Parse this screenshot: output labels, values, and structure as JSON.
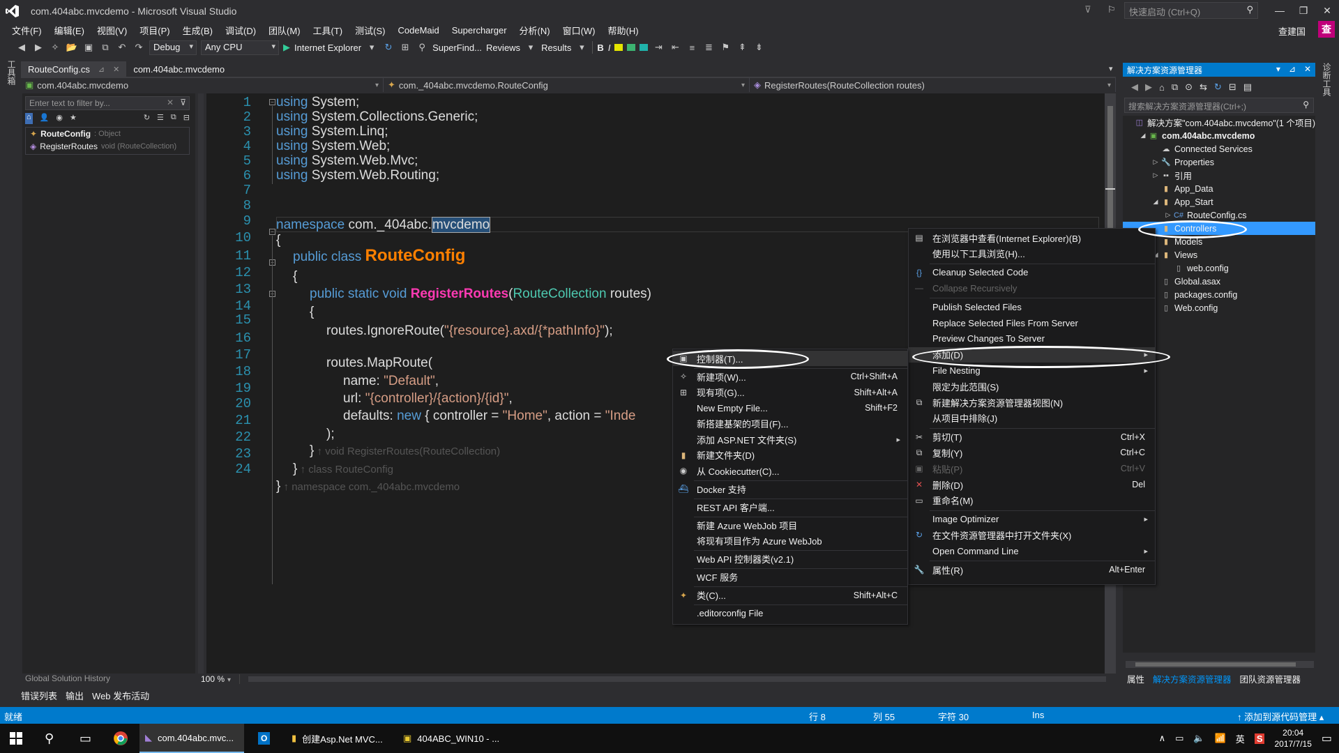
{
  "window": {
    "title": "com.404abc.mvcdemo - Microsoft Visual Studio",
    "quick_launch_placeholder": "快速启动 (Ctrl+Q)",
    "user_name": "查建国",
    "user_initial": "查"
  },
  "menubar": [
    "文件(F)",
    "编辑(E)",
    "视图(V)",
    "项目(P)",
    "生成(B)",
    "调试(D)",
    "团队(M)",
    "工具(T)",
    "测试(S)",
    "CodeMaid",
    "Supercharger",
    "分析(N)",
    "窗口(W)",
    "帮助(H)"
  ],
  "toolbar": {
    "config": "Debug",
    "platform": "Any CPU",
    "run_target": "Internet Explorer",
    "superfind": "SuperFind...",
    "reviews": "Reviews",
    "results": "Results",
    "bold": "B",
    "italic": "I"
  },
  "left_strip_label": "工具箱",
  "doc_tabs": [
    {
      "label": "RouteConfig.cs",
      "active": true
    },
    {
      "label": "com.404abc.mvcdemo",
      "active": false
    }
  ],
  "navbar": {
    "project": "com.404abc.mvcdemo",
    "class": "com._404abc.mvcdemo.RouteConfig",
    "member": "RegisterRoutes(RouteCollection routes)"
  },
  "class_view": {
    "filter_placeholder": "Enter text to filter by...",
    "rows": [
      {
        "name": "RouteConfig",
        "meta": ": Object"
      },
      {
        "name": "RegisterRoutes",
        "meta": "void (RouteCollection)"
      }
    ],
    "history_label": "Global Solution History"
  },
  "editor": {
    "zoom": "100 %",
    "line_numbers": [
      "1",
      "2",
      "3",
      "4",
      "5",
      "6",
      "7",
      "8",
      "9",
      "10",
      "11",
      "12",
      "13",
      "14",
      "15",
      "16",
      "17",
      "18",
      "19",
      "20",
      "21",
      "22",
      "23",
      "24"
    ],
    "code": {
      "l1_kw": "using",
      "l1_rest": " System;",
      "l2_kw": "using",
      "l2_rest": " System.Collections.Generic;",
      "l3_kw": "using",
      "l3_rest": " System.Linq;",
      "l4_kw": "using",
      "l4_rest": " System.Web;",
      "l5_kw": "using",
      "l5_rest": " System.Web.Mvc;",
      "l6_kw": "using",
      "l6_rest": " System.Web.Routing;",
      "l8_kw": "namespace",
      "l8_mid": " com._404abc.",
      "l8_sel": "mvcdemo",
      "l9": "{",
      "l10_kw": "public class ",
      "l10_name": "RouteConfig",
      "l11": "{",
      "l12_kw": "public static void ",
      "l12_name": "RegisterRoutes",
      "l12_p1": "(",
      "l12_type": "RouteCollection",
      "l12_p2": " routes)",
      "l13": "{",
      "l14_a": "routes.IgnoreRoute(",
      "l14_str": "\"{resource}.axd/{*pathInfo}\"",
      "l14_b": ");",
      "l16": "routes.MapRoute(",
      "l17_a": "name: ",
      "l17_str": "\"Default\"",
      "l17_b": ",",
      "l18_a": "url: ",
      "l18_str": "\"{controller}/{action}/{id}\"",
      "l18_b": ",",
      "l19_a": "defaults: ",
      "l19_kw": "new",
      "l19_b": " { controller = ",
      "l19_str": "\"Home\"",
      "l19_c": ", action = ",
      "l19_str2": "\"Inde",
      "l20": ");",
      "l21_a": "}",
      "l21_hint": " ↑ void RegisterRoutes(RouteCollection)",
      "l22_a": "}",
      "l22_hint": " ↑ class RouteConfig",
      "l23_a": "}",
      "l23_hint": " ↑ namespace com._404abc.mvcdemo"
    }
  },
  "bottom_tabs": [
    "错误列表",
    "输出",
    "Web 发布活动"
  ],
  "solution_explorer": {
    "title": "解决方案资源管理器",
    "search_placeholder": "搜索解决方案资源管理器(Ctrl+;)",
    "tree": [
      {
        "label": "解决方案\"com.404abc.mvcdemo\"(1 个项目)",
        "indent": 0,
        "exp": "",
        "icon": "solution-icon"
      },
      {
        "label": "com.404abc.mvcdemo",
        "indent": 1,
        "exp": "◢",
        "icon": "project-icon"
      },
      {
        "label": "Connected Services",
        "indent": 2,
        "exp": "",
        "icon": "connected-services-icon"
      },
      {
        "label": "Properties",
        "indent": 2,
        "exp": "▷",
        "icon": "wrench-icon"
      },
      {
        "label": "引用",
        "indent": 2,
        "exp": "▷",
        "icon": "references-icon"
      },
      {
        "label": "App_Data",
        "indent": 2,
        "exp": "",
        "icon": "folder-icon"
      },
      {
        "label": "App_Start",
        "indent": 2,
        "exp": "◢",
        "icon": "folder-icon"
      },
      {
        "label": "RouteConfig.cs",
        "indent": 3,
        "exp": "▷",
        "icon": "csharp-file-icon"
      },
      {
        "label": "Controllers",
        "indent": 2,
        "exp": "",
        "icon": "folder-icon",
        "selected": true
      },
      {
        "label": "Models",
        "indent": 2,
        "exp": "",
        "icon": "folder-icon"
      },
      {
        "label": "Views",
        "indent": 2,
        "exp": "◢",
        "icon": "folder-icon"
      },
      {
        "label": "web.config",
        "indent": 3,
        "exp": "",
        "icon": "config-file-icon"
      },
      {
        "label": "Global.asax",
        "indent": 2,
        "exp": "",
        "icon": "config-file-icon"
      },
      {
        "label": "packages.config",
        "indent": 2,
        "exp": "",
        "icon": "config-file-icon"
      },
      {
        "label": "Web.config",
        "indent": 2,
        "exp": "",
        "icon": "config-file-icon"
      }
    ],
    "bottom_tabs": [
      "属性",
      "解决方案资源管理器",
      "团队资源管理器"
    ]
  },
  "right_strip_label": "诊断工具",
  "context_menu_main": [
    {
      "label": "在浏览器中查看(Internet Explorer)(B)",
      "sc": "",
      "icon": "ie-icon"
    },
    {
      "label": "使用以下工具浏览(H)...",
      "sc": "",
      "icon": ""
    },
    {
      "sep": true
    },
    {
      "label": "Cleanup Selected Code",
      "sc": "",
      "icon": "braces-icon"
    },
    {
      "label": "Collapse Recursively",
      "sc": "",
      "icon": "collapse-icon",
      "disabled": true
    },
    {
      "sep": true
    },
    {
      "label": "Publish Selected Files",
      "sc": "",
      "icon": ""
    },
    {
      "label": "Replace Selected Files From Server",
      "sc": "",
      "icon": ""
    },
    {
      "label": "Preview Changes To Server",
      "sc": "",
      "icon": ""
    },
    {
      "label": "添加(D)",
      "sc": "",
      "icon": "",
      "sub": true,
      "hi": true
    },
    {
      "label": "File Nesting",
      "sc": "",
      "icon": "",
      "sub": true
    },
    {
      "label": "限定为此范围(S)",
      "sc": "",
      "icon": ""
    },
    {
      "label": "新建解决方案资源管理器视图(N)",
      "sc": "",
      "icon": "new-view-icon"
    },
    {
      "label": "从项目中排除(J)",
      "sc": "",
      "icon": ""
    },
    {
      "sep": true
    },
    {
      "label": "剪切(T)",
      "sc": "Ctrl+X",
      "icon": "cut-icon"
    },
    {
      "label": "复制(Y)",
      "sc": "Ctrl+C",
      "icon": "copy-icon"
    },
    {
      "label": "粘贴(P)",
      "sc": "Ctrl+V",
      "icon": "paste-icon",
      "disabled": true
    },
    {
      "label": "删除(D)",
      "sc": "Del",
      "icon": "delete-icon"
    },
    {
      "label": "重命名(M)",
      "sc": "",
      "icon": "rename-icon"
    },
    {
      "sep": true
    },
    {
      "label": "Image Optimizer",
      "sc": "",
      "icon": "",
      "sub": true
    },
    {
      "label": "在文件资源管理器中打开文件夹(X)",
      "sc": "",
      "icon": "refresh-folder-icon"
    },
    {
      "label": "Open Command Line",
      "sc": "",
      "icon": "",
      "sub": true
    },
    {
      "sep": true
    },
    {
      "label": "属性(R)",
      "sc": "Alt+Enter",
      "icon": "wrench-icon"
    }
  ],
  "context_menu_add": [
    {
      "label": "控制器(T)...",
      "sc": "",
      "icon": "controller-icon",
      "hi": true
    },
    {
      "sep": true
    },
    {
      "label": "新建项(W)...",
      "sc": "Ctrl+Shift+A",
      "icon": "new-item-icon"
    },
    {
      "label": "现有项(G)...",
      "sc": "Shift+Alt+A",
      "icon": "existing-item-icon"
    },
    {
      "label": "New Empty File...",
      "sc": "Shift+F2",
      "icon": ""
    },
    {
      "label": "新搭建基架的项目(F)...",
      "sc": "",
      "icon": ""
    },
    {
      "label": "添加 ASP.NET 文件夹(S)",
      "sc": "",
      "icon": "",
      "sub": true
    },
    {
      "label": "新建文件夹(D)",
      "sc": "",
      "icon": "new-folder-icon"
    },
    {
      "label": "从 Cookiecutter(C)...",
      "sc": "",
      "icon": "cookiecutter-icon"
    },
    {
      "sep": true
    },
    {
      "label": "Docker 支持",
      "sc": "",
      "icon": "docker-icon"
    },
    {
      "sep": true
    },
    {
      "label": "REST API 客户端...",
      "sc": "",
      "icon": ""
    },
    {
      "sep": true
    },
    {
      "label": "新建 Azure WebJob 项目",
      "sc": "",
      "icon": ""
    },
    {
      "label": "将现有项目作为 Azure WebJob",
      "sc": "",
      "icon": ""
    },
    {
      "sep": true
    },
    {
      "label": "Web API 控制器类(v2.1)",
      "sc": "",
      "icon": ""
    },
    {
      "sep": true
    },
    {
      "label": "WCF 服务",
      "sc": "",
      "icon": ""
    },
    {
      "sep": true
    },
    {
      "label": "类(C)...",
      "sc": "Shift+Alt+C",
      "icon": "class-icon"
    },
    {
      "sep": true
    },
    {
      ".label": "",
      "label": ".editorconfig File",
      "sc": "",
      "icon": ""
    }
  ],
  "statusbar": {
    "ready": "就绪",
    "line": "行 8",
    "col": "列 55",
    "char": "字符 30",
    "mode": "Ins",
    "source_control": "↑ 添加到源代码管理 ▴"
  },
  "taskbar": {
    "items": [
      "com.404abc.mvc...",
      "创建Asp.Net MVC...",
      "404ABC_WIN10 - ..."
    ],
    "ime": "英",
    "time": "20:04",
    "date": "2017/7/15"
  },
  "colors": {
    "accent": "#007acc",
    "selected_row": "#3399ff",
    "editor_bg": "#1e1e1e"
  }
}
